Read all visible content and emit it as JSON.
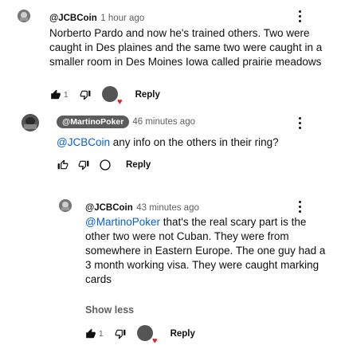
{
  "comment1": {
    "handle": "@JCBCoin",
    "time": "1 hour ago",
    "text": "Norberto Pardo and now he's trained others.   Two were caught in Des plaines and the same two were caught in a smaller room in Des Moines Iowa called prairie meadows",
    "like_count": "1",
    "reply_label": "Reply"
  },
  "comment2": {
    "handle_badge": "@MartinoPoker",
    "time": "46 minutes ago",
    "mention": "@JCBCoin",
    "text": " any info on the others in their ring?",
    "reply_label": "Reply"
  },
  "comment3": {
    "handle": "@JCBCoin",
    "time": "43 minutes ago",
    "mention": "@MartinoPoker",
    "text": "  that's the real scary part is the other two were not Cuban.  They were from somewhere in Eastern Europe.  The one guy had a 3 month working visa.  They were caught marking cards",
    "show_less": "Show less",
    "like_count": "1",
    "reply_label": "Reply"
  },
  "icons": {
    "like": "thumbs-up-icon",
    "dislike": "thumbs-down-icon",
    "more": "more-vert-icon",
    "heart": "creator-heart-icon",
    "comment": "comment-icon"
  },
  "colors": {
    "mention": "#065fd4",
    "heart": "#e4242a",
    "badge_bg": "#5c5c5c"
  }
}
